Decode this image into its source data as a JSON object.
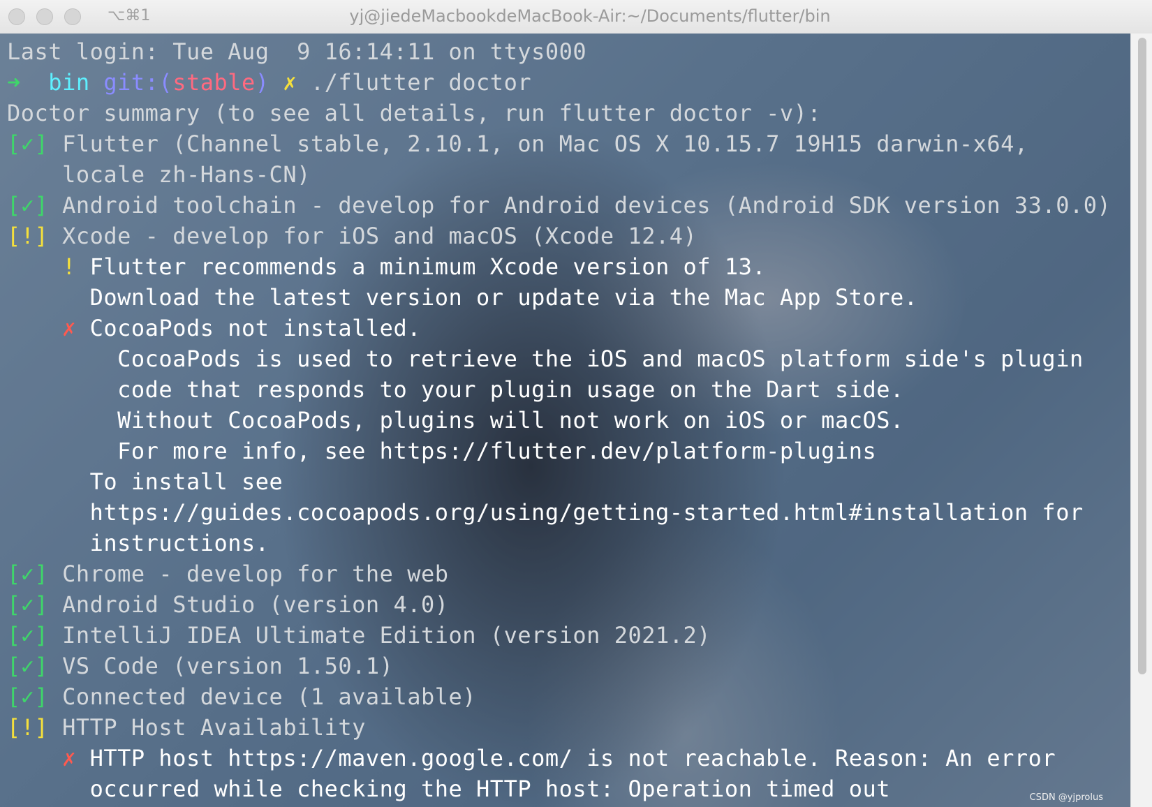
{
  "window": {
    "shortcut": "⌥⌘1",
    "title": "yj@jiedeMacbookdeMacBook-Air:~/Documents/flutter/bin"
  },
  "terminal": {
    "last_login": "Last login: Tue Aug  9 16:14:11 on ttys000",
    "prompt": {
      "arrow": "➜",
      "dir": "bin",
      "git_prefix": "git:(",
      "branch": "stable",
      "git_suffix": ")",
      "dirty": "✗",
      "command": "./flutter doctor"
    },
    "summary": "Doctor summary (to see all details, run flutter doctor -v):",
    "checks": [
      {
        "status": "[✓]",
        "text": "Flutter (Channel stable, 2.10.1, on Mac OS X 10.15.7 19H15 darwin-x64,"
      },
      {
        "continuation": "locale zh-Hans-CN)"
      },
      {
        "status": "[✓]",
        "text": "Android toolchain - develop for Android devices (Android SDK version 33.0.0)"
      },
      {
        "status": "[!]",
        "text": "Xcode - develop for iOS and macOS (Xcode 12.4)"
      }
    ],
    "xcode_details": {
      "warn_mark": "!",
      "warn_line1": "Flutter recommends a minimum Xcode version of 13.",
      "warn_line2": "Download the latest version or update via the Mac App Store.",
      "err_mark": "✗",
      "err_line": "CocoaPods not installed.",
      "sub_lines": [
        "CocoaPods is used to retrieve the iOS and macOS platform side's plugin",
        "code that responds to your plugin usage on the Dart side.",
        "Without CocoaPods, plugins will not work on iOS or macOS.",
        "For more info, see https://flutter.dev/platform-plugins"
      ],
      "install_lines": [
        "To install see",
        "https://guides.cocoapods.org/using/getting-started.html#installation for",
        "instructions."
      ]
    },
    "more_checks": [
      {
        "status": "[✓]",
        "text": "Chrome - develop for the web"
      },
      {
        "status": "[✓]",
        "text": "Android Studio (version 4.0)"
      },
      {
        "status": "[✓]",
        "text": "IntelliJ IDEA Ultimate Edition (version 2021.2)"
      },
      {
        "status": "[✓]",
        "text": "VS Code (version 1.50.1)"
      },
      {
        "status": "[✓]",
        "text": "Connected device (1 available)"
      },
      {
        "status": "[!]",
        "text": "HTTP Host Availability"
      }
    ],
    "http_details": {
      "err_mark": "✗",
      "line1": "HTTP host https://maven.google.com/ is not reachable. Reason: An error",
      "line2": "occurred while checking the HTTP host: Operation timed out"
    }
  },
  "watermark": "CSDN @yjprolus"
}
